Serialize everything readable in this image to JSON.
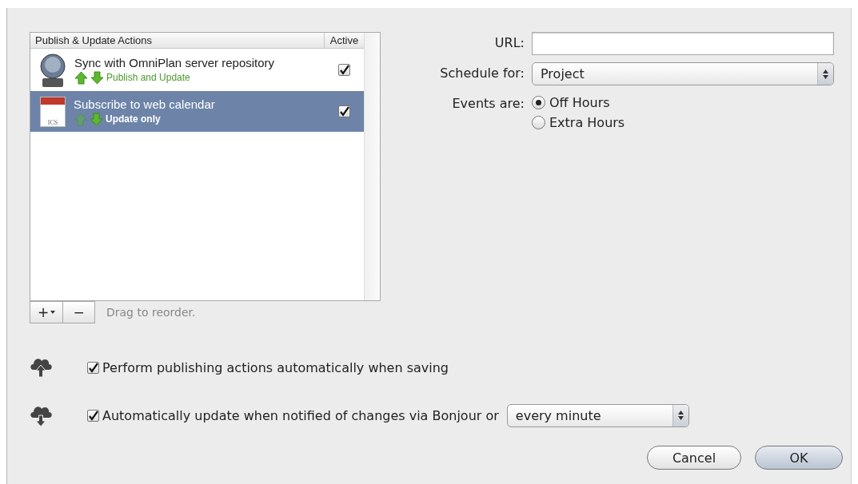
{
  "actions_list": {
    "columns": [
      "Publish & Update Actions",
      "Active"
    ],
    "rows": [
      {
        "kind": "server",
        "title": "Sync with OmniPlan server repository",
        "mode": "Publish and Update",
        "publishes": true,
        "active": true,
        "selected": false
      },
      {
        "kind": "calendar",
        "icon_text": "ICS",
        "title": "Subscribe to web calendar",
        "mode": "Update only",
        "publishes": false,
        "active": true,
        "selected": true
      }
    ],
    "add_button": "+",
    "remove_button": "−",
    "hint": "Drag to reorder."
  },
  "form": {
    "url": {
      "label": "URL:"
    },
    "schedule": {
      "label": "Schedule for:",
      "value": "Project"
    },
    "events": {
      "label": "Events are:",
      "options": [
        {
          "label": "Off Hours",
          "selected": true
        },
        {
          "label": "Extra Hours",
          "selected": false
        }
      ]
    }
  },
  "options": [
    {
      "kind": "publish",
      "label": "Perform publishing actions automatically when saving",
      "checked": true
    },
    {
      "kind": "update",
      "label": "Automatically update when notified of changes via Bonjour or",
      "checked": true,
      "interval": "every minute"
    }
  ],
  "buttons": [
    {
      "label": "Cancel",
      "default": false
    },
    {
      "label": "OK",
      "default": true
    }
  ]
}
